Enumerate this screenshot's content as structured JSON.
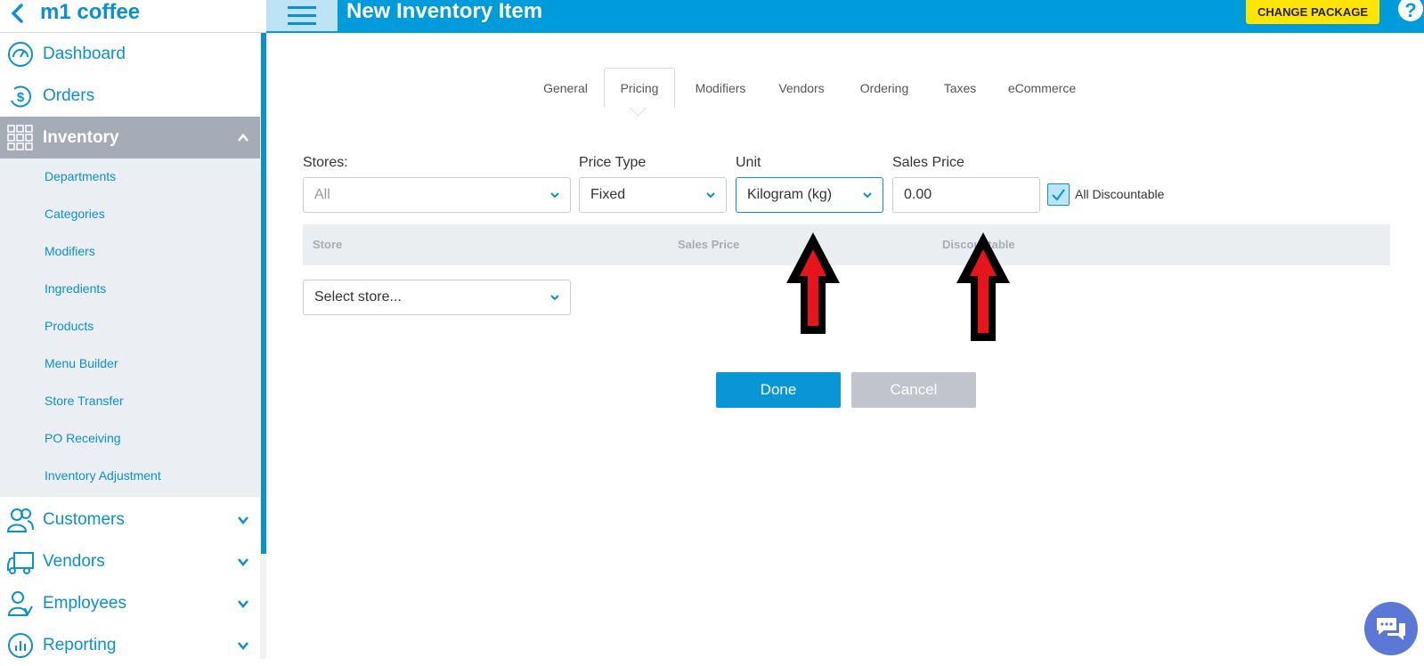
{
  "app": {
    "name": "m1 coffee"
  },
  "header": {
    "title": "New Inventory Item",
    "change_package": "CHANGE PACKAGE"
  },
  "sidebar": {
    "items": [
      {
        "label": "Dashboard"
      },
      {
        "label": "Orders"
      },
      {
        "label": "Inventory"
      },
      {
        "label": "Customers"
      },
      {
        "label": "Vendors"
      },
      {
        "label": "Employees"
      },
      {
        "label": "Reporting"
      }
    ],
    "inventory_submenu": [
      "Departments",
      "Categories",
      "Modifiers",
      "Ingredients",
      "Products",
      "Menu Builder",
      "Store Transfer",
      "PO Receiving",
      "Inventory Adjustment"
    ]
  },
  "tabs": [
    "General",
    "Pricing",
    "Modifiers",
    "Vendors",
    "Ordering",
    "Taxes",
    "eCommerce"
  ],
  "form": {
    "stores_label": "Stores:",
    "stores_placeholder": "All",
    "price_type_label": "Price Type",
    "price_type_value": "Fixed",
    "unit_label": "Unit",
    "unit_value": "Kilogram (kg)",
    "sales_price_label": "Sales Price",
    "sales_price_value": "0.00",
    "all_discountable_label": "All Discountable",
    "all_discountable_checked": true
  },
  "table": {
    "headers": [
      "Store",
      "Sales Price",
      "Discountable"
    ]
  },
  "select_store_placeholder": "Select store...",
  "buttons": {
    "done": "Done",
    "cancel": "Cancel"
  },
  "colors": {
    "primary": "#009bdb",
    "accent_yellow": "#ffe500",
    "active_nav": "#a5acb8"
  },
  "icons": [
    "back-chevron-icon",
    "hamburger-icon",
    "help-icon",
    "dashboard-icon",
    "orders-icon",
    "inventory-grid-icon",
    "customers-icon",
    "vendors-truck-icon",
    "employees-icon",
    "reporting-icon",
    "chat-icon"
  ]
}
